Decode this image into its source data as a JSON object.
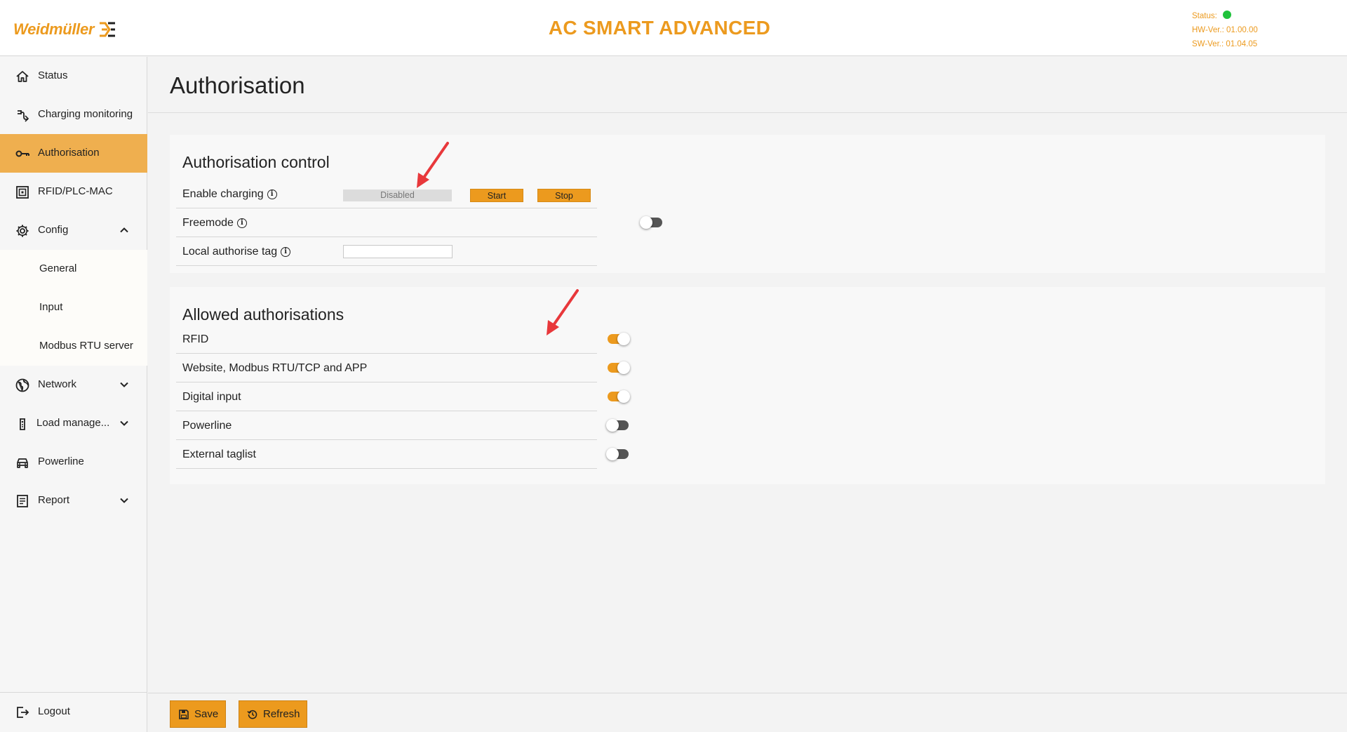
{
  "header": {
    "logo_text": "Weidmüller",
    "app_title": "AC SMART ADVANCED",
    "status_label": "Status:",
    "status_color": "#1fc23b",
    "hw_version": "HW-Ver.: 01.00.00",
    "sw_version": "SW-Ver.: 01.04.05",
    "accent_color": "#ec9a1e"
  },
  "sidebar": {
    "items": [
      {
        "label": "Status",
        "icon": "home-icon"
      },
      {
        "label": "Charging monitoring",
        "icon": "charging-plug-icon"
      },
      {
        "label": "Authorisation",
        "icon": "key-icon",
        "active": true
      },
      {
        "label": "RFID/PLC-MAC",
        "icon": "rfid-card-icon"
      },
      {
        "label": "Config",
        "icon": "gear-icon",
        "expanded": true
      },
      {
        "label": "General",
        "sub": true
      },
      {
        "label": "Input",
        "sub": true
      },
      {
        "label": "Modbus RTU server",
        "sub": true
      },
      {
        "label": "Network",
        "icon": "globe-icon"
      },
      {
        "label": "Load manage...",
        "icon": "load-management-icon"
      },
      {
        "label": "Powerline",
        "icon": "car-icon"
      },
      {
        "label": "Report",
        "icon": "report-icon"
      }
    ],
    "logout_label": "Logout"
  },
  "main": {
    "page_title": "Authorisation",
    "auth_control": {
      "title": "Authorisation control",
      "enable_charging_label": "Enable charging",
      "enable_charging_value": "Disabled",
      "start_label": "Start",
      "stop_label": "Stop",
      "freemode_label": "Freemode",
      "freemode_on": false,
      "local_tag_label": "Local authorise tag",
      "local_tag_value": ""
    },
    "allowed": {
      "title": "Allowed authorisations",
      "items": [
        {
          "label": "RFID",
          "on": true
        },
        {
          "label": "Website, Modbus RTU/TCP and APP",
          "on": true
        },
        {
          "label": "Digital input",
          "on": true
        },
        {
          "label": "Powerline",
          "on": false
        },
        {
          "label": "External taglist",
          "on": false
        }
      ]
    }
  },
  "footer": {
    "save_label": "Save",
    "refresh_label": "Refresh"
  }
}
